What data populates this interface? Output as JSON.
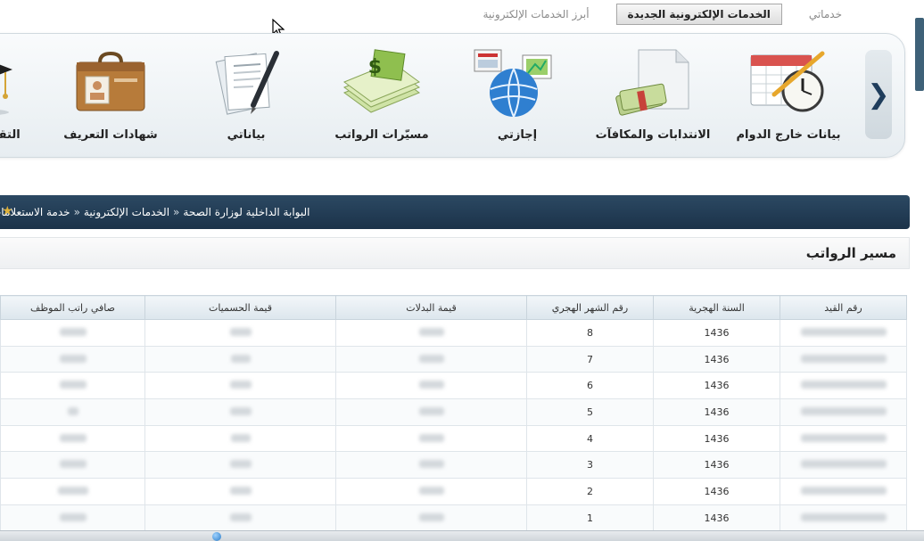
{
  "top_tabs": [
    {
      "label": "أبرز الخدمات الإلكترونية",
      "active": false
    },
    {
      "label": "الخدمات الإلكترونية الجديدة",
      "active": true
    },
    {
      "label": "خدماتي",
      "active": false
    }
  ],
  "services": [
    {
      "label": "التقديم للإبتعاث",
      "icon": "graduation-cap-icon"
    },
    {
      "label": "شهادات التعريف",
      "icon": "briefcase-icon"
    },
    {
      "label": "بياناتي",
      "icon": "document-pen-icon"
    },
    {
      "label": "مسيّرات الرواتب",
      "icon": "money-stack-icon"
    },
    {
      "label": "إجازتي",
      "icon": "globe-screens-icon"
    },
    {
      "label": "الانتدابات والمكافآت",
      "icon": "page-money-icon"
    },
    {
      "label": "بيانات خارج الدوام",
      "icon": "calendar-clock-icon"
    }
  ],
  "carousel_arrow": "❯",
  "breadcrumb": {
    "items": [
      "البوابة الداخلية لوزارة الصحة",
      "الخدمات الإلكترونية",
      "خدمة الاستعلامات"
    ],
    "separator": "«"
  },
  "section_title": "مسير الرواتب",
  "table": {
    "columns": [
      "رقم القيد",
      "السنة الهجرية",
      "رقم الشهر الهجري",
      "قيمة البدلات",
      "قيمة الحسميات",
      "صافي راتب الموظف"
    ],
    "rows": [
      {
        "year": "1436",
        "month": "8"
      },
      {
        "year": "1436",
        "month": "7"
      },
      {
        "year": "1436",
        "month": "6"
      },
      {
        "year": "1436",
        "month": "5"
      },
      {
        "year": "1436",
        "month": "4"
      },
      {
        "year": "1436",
        "month": "3"
      },
      {
        "year": "1436",
        "month": "2"
      },
      {
        "year": "1436",
        "month": "1"
      }
    ]
  },
  "colors": {
    "breadcrumb_bg": "#233d55",
    "accent": "#1f3d5c"
  }
}
